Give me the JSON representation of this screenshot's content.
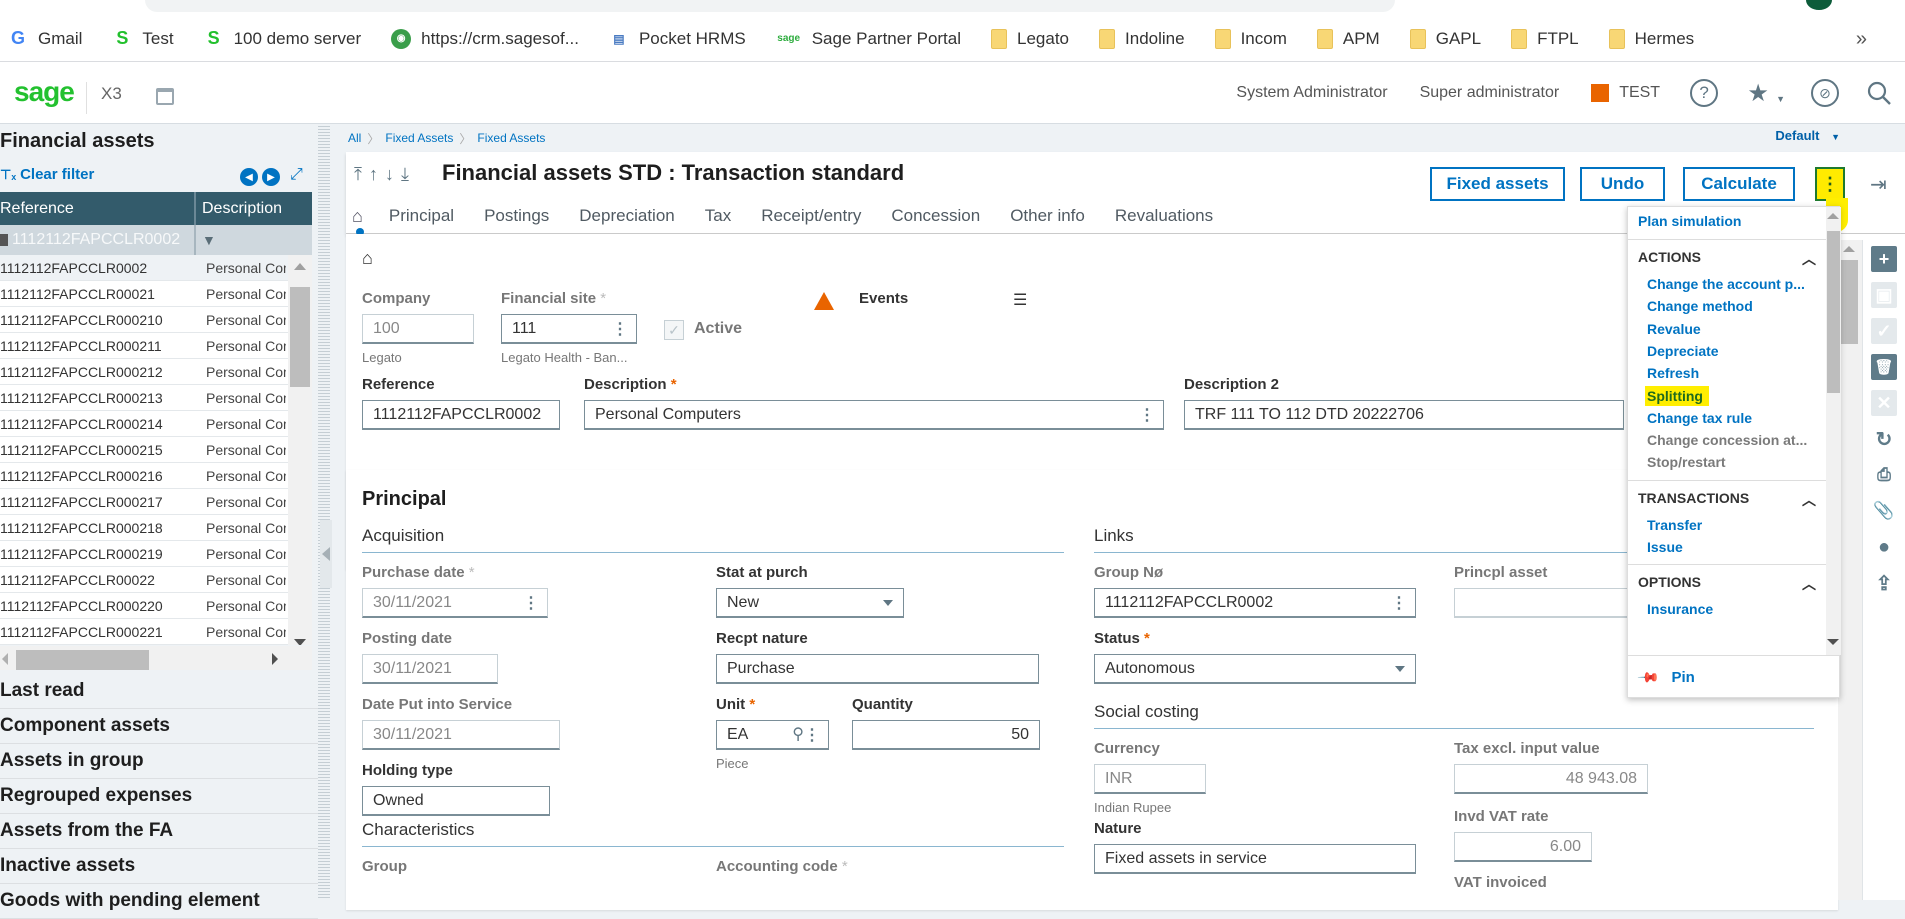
{
  "browser": {
    "bookmarks": [
      {
        "label": "Gmail",
        "icon": "google-icon"
      },
      {
        "label": "Test",
        "icon": "sage-s-icon"
      },
      {
        "label": "100 demo server",
        "icon": "sage-s-icon"
      },
      {
        "label": "https://crm.sagesof...",
        "icon": "crm-icon"
      },
      {
        "label": "Pocket HRMS",
        "icon": "hrms-icon"
      },
      {
        "label": "Sage Partner Portal",
        "icon": "sage-logo-icon"
      },
      {
        "label": "Legato",
        "icon": "folder-icon"
      },
      {
        "label": "Indoline",
        "icon": "folder-icon"
      },
      {
        "label": "Incom",
        "icon": "folder-icon"
      },
      {
        "label": "APM",
        "icon": "folder-icon"
      },
      {
        "label": "GAPL",
        "icon": "folder-icon"
      },
      {
        "label": "FTPL",
        "icon": "folder-icon"
      },
      {
        "label": "Hermes",
        "icon": "folder-icon"
      }
    ],
    "more": "»"
  },
  "header": {
    "logo": "sage",
    "product": "X3",
    "user": "System Administrator",
    "role": "Super administrator",
    "environment": "TEST",
    "environment_color": "#e96400"
  },
  "left_panel": {
    "title": "Financial assets",
    "clear_filter": "Clear filter",
    "columns": [
      "Reference",
      "Description"
    ],
    "filter_value": "1112112FAPCCLR0002",
    "rows": [
      {
        "ref": "1112112FAPCCLR0002",
        "desc": "Personal Computers"
      },
      {
        "ref": "1112112FAPCCLR00021",
        "desc": "Personal Computers"
      },
      {
        "ref": "1112112FAPCCLR000210",
        "desc": "Personal Computers"
      },
      {
        "ref": "1112112FAPCCLR000211",
        "desc": "Personal Computers"
      },
      {
        "ref": "1112112FAPCCLR000212",
        "desc": "Personal Computers"
      },
      {
        "ref": "1112112FAPCCLR000213",
        "desc": "Personal Computers"
      },
      {
        "ref": "1112112FAPCCLR000214",
        "desc": "Personal Computers"
      },
      {
        "ref": "1112112FAPCCLR000215",
        "desc": "Personal Computers"
      },
      {
        "ref": "1112112FAPCCLR000216",
        "desc": "Personal Computers"
      },
      {
        "ref": "1112112FAPCCLR000217",
        "desc": "Personal Computers"
      },
      {
        "ref": "1112112FAPCCLR000218",
        "desc": "Personal Computers"
      },
      {
        "ref": "1112112FAPCCLR000219",
        "desc": "Personal Computers"
      },
      {
        "ref": "1112112FAPCCLR00022",
        "desc": "Personal Computers"
      },
      {
        "ref": "1112112FAPCCLR000220",
        "desc": "Personal Computers"
      },
      {
        "ref": "1112112FAPCCLR000221",
        "desc": "Personal Computers"
      }
    ],
    "links": [
      "Last read",
      "Component assets",
      "Assets in group",
      "Regrouped expenses",
      "Assets from the FA",
      "Inactive assets",
      "Goods with pending element"
    ]
  },
  "main": {
    "breadcrumb": [
      "All",
      "Fixed Assets",
      "Fixed Assets"
    ],
    "view_selector": "Default",
    "title": "Financial assets STD : Transaction standard",
    "tabs": [
      "Principal",
      "Postings",
      "Depreciation",
      "Tax",
      "Receipt/entry",
      "Concession",
      "Other info",
      "Revaluations"
    ],
    "buttons": {
      "fixed_assets": "Fixed assets",
      "undo": "Undo",
      "calculate": "Calculate"
    },
    "header_fields": {
      "company_label": "Company",
      "company": "100",
      "company_desc": "Legato",
      "site_label": "Financial site",
      "site": "111",
      "site_desc": "Legato Health - Ban...",
      "active_label": "Active",
      "events_label": "Events",
      "reference_label": "Reference",
      "reference": "1112112FAPCCLR0002",
      "description_label": "Description",
      "description": "Personal Computers",
      "description2_label": "Description 2",
      "description2": "TRF 111 TO 112 DTD 20222706"
    },
    "principal": {
      "section_title": "Principal",
      "acquisition": {
        "title": "Acquisition",
        "purchase_date_label": "Purchase date",
        "purchase_date": "30/11/2021",
        "posting_date_label": "Posting date",
        "posting_date": "30/11/2021",
        "service_date_label": "Date Put into Service",
        "service_date": "30/11/2021",
        "holding_type_label": "Holding type",
        "holding_type": "Owned",
        "stat_label": "Stat at purch",
        "stat": "New",
        "recpt_label": "Recpt nature",
        "recpt": "Purchase",
        "unit_label": "Unit",
        "unit": "EA",
        "unit_desc": "Piece",
        "qty_label": "Quantity",
        "qty": "50"
      },
      "characteristics": {
        "title": "Characteristics",
        "group_label": "Group",
        "accounting_code_label": "Accounting code"
      },
      "links": {
        "title": "Links",
        "group_no_label": "Group Nø",
        "group_no": "1112112FAPCCLR0002",
        "princpl_label": "Princpl asset",
        "princpl": "",
        "status_label": "Status",
        "status": "Autonomous"
      },
      "social_costing": {
        "title": "Social costing",
        "currency_label": "Currency",
        "currency": "INR",
        "currency_desc": "Indian Rupee",
        "nature_label": "Nature",
        "nature": "Fixed assets in service",
        "tax_excl_label": "Tax excl. input value",
        "tax_excl": "48 943.08",
        "vat_rate_label": "Invd VAT rate",
        "vat_rate": "6.00",
        "vat_invoiced_label": "VAT invoiced"
      }
    }
  },
  "menu": {
    "top_item": "Plan simulation",
    "sections": [
      {
        "title": "ACTIONS",
        "items": [
          {
            "label": "Change the account p...",
            "enabled": true
          },
          {
            "label": "Change method",
            "enabled": true
          },
          {
            "label": "Revalue",
            "enabled": true
          },
          {
            "label": "Depreciate",
            "enabled": true
          },
          {
            "label": "Refresh",
            "enabled": true
          },
          {
            "label": "Splitting",
            "enabled": true,
            "highlighted": true
          },
          {
            "label": "Change tax rule",
            "enabled": true
          },
          {
            "label": "Change concession at...",
            "enabled": false
          },
          {
            "label": "Stop/restart",
            "enabled": false
          }
        ]
      },
      {
        "title": "TRANSACTIONS",
        "items": [
          {
            "label": "Transfer",
            "enabled": true
          },
          {
            "label": "Issue",
            "enabled": true
          }
        ]
      },
      {
        "title": "OPTIONS",
        "items": [
          {
            "label": "Insurance",
            "enabled": true
          }
        ]
      }
    ],
    "pin": "Pin",
    "highlight_color": "#ffee00"
  }
}
